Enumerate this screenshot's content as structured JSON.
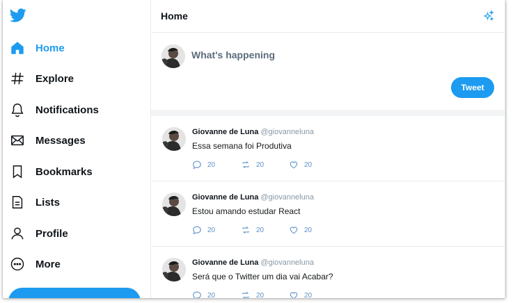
{
  "sidebar": {
    "logo": "twitter-bird-icon",
    "items": [
      {
        "label": "Home",
        "icon": "home-icon",
        "active": true
      },
      {
        "label": "Explore",
        "icon": "hashtag-icon"
      },
      {
        "label": "Notifications",
        "icon": "bell-icon"
      },
      {
        "label": "Messages",
        "icon": "envelope-icon"
      },
      {
        "label": "Bookmarks",
        "icon": "bookmark-icon"
      },
      {
        "label": "Lists",
        "icon": "list-document-icon"
      },
      {
        "label": "Profile",
        "icon": "person-icon"
      },
      {
        "label": "More",
        "icon": "more-circle-icon"
      }
    ]
  },
  "header": {
    "title": "Home",
    "icon": "sparkle-icon"
  },
  "composer": {
    "placeholder": "What's happening",
    "button_label": "Tweet"
  },
  "tweets": [
    {
      "name": "Giovanne de Luna",
      "handle": "@giovanneluna",
      "text": "Essa semana foi Produtiva",
      "replies": "20",
      "retweets": "20",
      "likes": "20"
    },
    {
      "name": "Giovanne de Luna",
      "handle": "@giovanneluna",
      "text": "Estou amando estudar React",
      "replies": "20",
      "retweets": "20",
      "likes": "20"
    },
    {
      "name": "Giovanne de Luna",
      "handle": "@giovanneluna",
      "text": "Será que o Twitter um dia vai Acabar?",
      "replies": "20",
      "retweets": "20",
      "likes": "20"
    }
  ],
  "colors": {
    "accent": "#1d9bf0",
    "text": "#0f1419",
    "muted": "#8899a6"
  }
}
